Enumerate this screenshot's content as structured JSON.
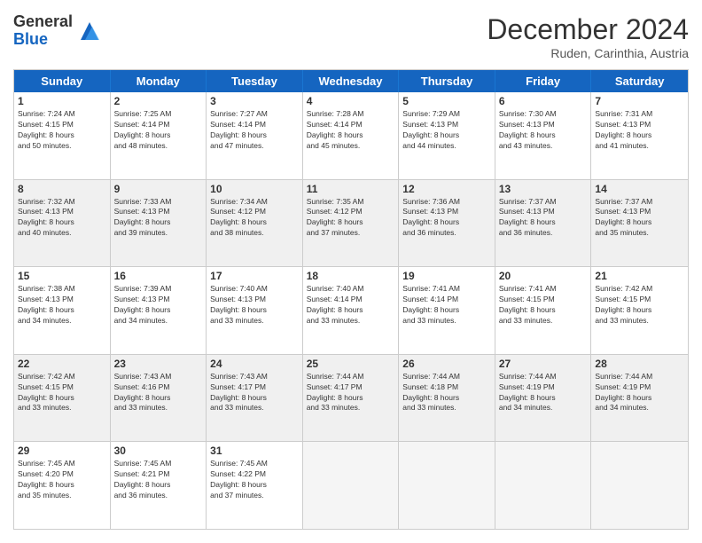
{
  "logo": {
    "general": "General",
    "blue": "Blue"
  },
  "title": "December 2024",
  "subtitle": "Ruden, Carinthia, Austria",
  "days": [
    "Sunday",
    "Monday",
    "Tuesday",
    "Wednesday",
    "Thursday",
    "Friday",
    "Saturday"
  ],
  "weeks": [
    [
      {
        "day": "1",
        "lines": [
          "Sunrise: 7:24 AM",
          "Sunset: 4:15 PM",
          "Daylight: 8 hours",
          "and 50 minutes."
        ]
      },
      {
        "day": "2",
        "lines": [
          "Sunrise: 7:25 AM",
          "Sunset: 4:14 PM",
          "Daylight: 8 hours",
          "and 48 minutes."
        ]
      },
      {
        "day": "3",
        "lines": [
          "Sunrise: 7:27 AM",
          "Sunset: 4:14 PM",
          "Daylight: 8 hours",
          "and 47 minutes."
        ]
      },
      {
        "day": "4",
        "lines": [
          "Sunrise: 7:28 AM",
          "Sunset: 4:14 PM",
          "Daylight: 8 hours",
          "and 45 minutes."
        ]
      },
      {
        "day": "5",
        "lines": [
          "Sunrise: 7:29 AM",
          "Sunset: 4:13 PM",
          "Daylight: 8 hours",
          "and 44 minutes."
        ]
      },
      {
        "day": "6",
        "lines": [
          "Sunrise: 7:30 AM",
          "Sunset: 4:13 PM",
          "Daylight: 8 hours",
          "and 43 minutes."
        ]
      },
      {
        "day": "7",
        "lines": [
          "Sunrise: 7:31 AM",
          "Sunset: 4:13 PM",
          "Daylight: 8 hours",
          "and 41 minutes."
        ]
      }
    ],
    [
      {
        "day": "8",
        "lines": [
          "Sunrise: 7:32 AM",
          "Sunset: 4:13 PM",
          "Daylight: 8 hours",
          "and 40 minutes."
        ]
      },
      {
        "day": "9",
        "lines": [
          "Sunrise: 7:33 AM",
          "Sunset: 4:13 PM",
          "Daylight: 8 hours",
          "and 39 minutes."
        ]
      },
      {
        "day": "10",
        "lines": [
          "Sunrise: 7:34 AM",
          "Sunset: 4:12 PM",
          "Daylight: 8 hours",
          "and 38 minutes."
        ]
      },
      {
        "day": "11",
        "lines": [
          "Sunrise: 7:35 AM",
          "Sunset: 4:12 PM",
          "Daylight: 8 hours",
          "and 37 minutes."
        ]
      },
      {
        "day": "12",
        "lines": [
          "Sunrise: 7:36 AM",
          "Sunset: 4:13 PM",
          "Daylight: 8 hours",
          "and 36 minutes."
        ]
      },
      {
        "day": "13",
        "lines": [
          "Sunrise: 7:37 AM",
          "Sunset: 4:13 PM",
          "Daylight: 8 hours",
          "and 36 minutes."
        ]
      },
      {
        "day": "14",
        "lines": [
          "Sunrise: 7:37 AM",
          "Sunset: 4:13 PM",
          "Daylight: 8 hours",
          "and 35 minutes."
        ]
      }
    ],
    [
      {
        "day": "15",
        "lines": [
          "Sunrise: 7:38 AM",
          "Sunset: 4:13 PM",
          "Daylight: 8 hours",
          "and 34 minutes."
        ]
      },
      {
        "day": "16",
        "lines": [
          "Sunrise: 7:39 AM",
          "Sunset: 4:13 PM",
          "Daylight: 8 hours",
          "and 34 minutes."
        ]
      },
      {
        "day": "17",
        "lines": [
          "Sunrise: 7:40 AM",
          "Sunset: 4:13 PM",
          "Daylight: 8 hours",
          "and 33 minutes."
        ]
      },
      {
        "day": "18",
        "lines": [
          "Sunrise: 7:40 AM",
          "Sunset: 4:14 PM",
          "Daylight: 8 hours",
          "and 33 minutes."
        ]
      },
      {
        "day": "19",
        "lines": [
          "Sunrise: 7:41 AM",
          "Sunset: 4:14 PM",
          "Daylight: 8 hours",
          "and 33 minutes."
        ]
      },
      {
        "day": "20",
        "lines": [
          "Sunrise: 7:41 AM",
          "Sunset: 4:15 PM",
          "Daylight: 8 hours",
          "and 33 minutes."
        ]
      },
      {
        "day": "21",
        "lines": [
          "Sunrise: 7:42 AM",
          "Sunset: 4:15 PM",
          "Daylight: 8 hours",
          "and 33 minutes."
        ]
      }
    ],
    [
      {
        "day": "22",
        "lines": [
          "Sunrise: 7:42 AM",
          "Sunset: 4:15 PM",
          "Daylight: 8 hours",
          "and 33 minutes."
        ]
      },
      {
        "day": "23",
        "lines": [
          "Sunrise: 7:43 AM",
          "Sunset: 4:16 PM",
          "Daylight: 8 hours",
          "and 33 minutes."
        ]
      },
      {
        "day": "24",
        "lines": [
          "Sunrise: 7:43 AM",
          "Sunset: 4:17 PM",
          "Daylight: 8 hours",
          "and 33 minutes."
        ]
      },
      {
        "day": "25",
        "lines": [
          "Sunrise: 7:44 AM",
          "Sunset: 4:17 PM",
          "Daylight: 8 hours",
          "and 33 minutes."
        ]
      },
      {
        "day": "26",
        "lines": [
          "Sunrise: 7:44 AM",
          "Sunset: 4:18 PM",
          "Daylight: 8 hours",
          "and 33 minutes."
        ]
      },
      {
        "day": "27",
        "lines": [
          "Sunrise: 7:44 AM",
          "Sunset: 4:19 PM",
          "Daylight: 8 hours",
          "and 34 minutes."
        ]
      },
      {
        "day": "28",
        "lines": [
          "Sunrise: 7:44 AM",
          "Sunset: 4:19 PM",
          "Daylight: 8 hours",
          "and 34 minutes."
        ]
      }
    ],
    [
      {
        "day": "29",
        "lines": [
          "Sunrise: 7:45 AM",
          "Sunset: 4:20 PM",
          "Daylight: 8 hours",
          "and 35 minutes."
        ]
      },
      {
        "day": "30",
        "lines": [
          "Sunrise: 7:45 AM",
          "Sunset: 4:21 PM",
          "Daylight: 8 hours",
          "and 36 minutes."
        ]
      },
      {
        "day": "31",
        "lines": [
          "Sunrise: 7:45 AM",
          "Sunset: 4:22 PM",
          "Daylight: 8 hours",
          "and 37 minutes."
        ]
      },
      {
        "day": "",
        "lines": []
      },
      {
        "day": "",
        "lines": []
      },
      {
        "day": "",
        "lines": []
      },
      {
        "day": "",
        "lines": []
      }
    ]
  ]
}
